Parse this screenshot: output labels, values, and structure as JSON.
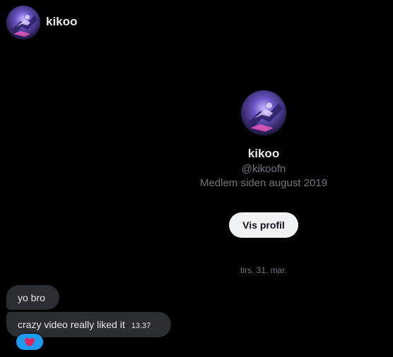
{
  "header": {
    "name": "kikoo",
    "avatar_icon": "avatar-icon"
  },
  "profile": {
    "name": "kikoo",
    "handle": "@kikoofn",
    "joined": "Medlem siden august 2019",
    "button_label": "Vis profil",
    "avatar_icon": "avatar-icon"
  },
  "conversation": {
    "date_separator": "tirs. 31. mar.",
    "messages": [
      {
        "text": "yo bro"
      },
      {
        "text": "crazy video really liked it",
        "time": "13.37"
      }
    ],
    "reaction": {
      "icon": "heart-icon",
      "color": "#e0245e"
    }
  },
  "colors": {
    "background": "#000000",
    "bubble": "#2b2e31",
    "reaction_bg": "#1d9bf0",
    "secondary_text": "#71767b"
  }
}
